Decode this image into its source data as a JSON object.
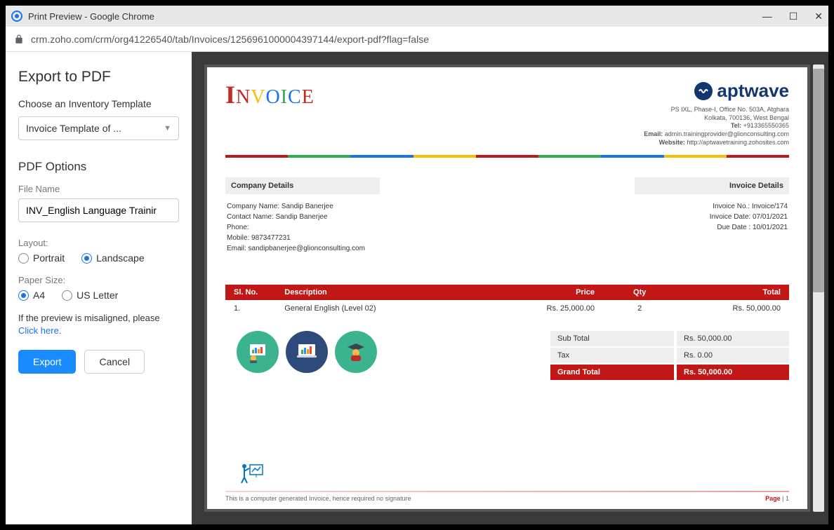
{
  "window": {
    "title": "Print Preview - Google Chrome",
    "url": "crm.zoho.com/crm/org41226540/tab/Invoices/1256961000004397144/export-pdf?flag=false"
  },
  "sidebar": {
    "heading": "Export to PDF",
    "template_label": "Choose an Inventory Template",
    "template_value": "Invoice Template of ...",
    "pdf_options_heading": "PDF Options",
    "filename_label": "File Name",
    "filename_value": "INV_English Language Trainir",
    "layout_label": "Layout:",
    "layout_options": {
      "portrait": "Portrait",
      "landscape": "Landscape"
    },
    "layout_selected": "landscape",
    "paper_label": "Paper Size:",
    "paper_options": {
      "a4": "A4",
      "usletter": "US Letter"
    },
    "paper_selected": "a4",
    "misaligned_text": "If the preview is misaligned, please",
    "click_here": "Click here.",
    "export_btn": "Export",
    "cancel_btn": "Cancel"
  },
  "invoice": {
    "title_chars": [
      "I",
      "N",
      "V",
      "O",
      "I",
      "C",
      "E"
    ],
    "brand_name": "aptwave",
    "address_line1": "PS IXL, Phase-I, Office No. 503A, Atghara",
    "address_line2": "Kolkata, 700136, West Bengal",
    "tel_label": "Tel:",
    "tel": "+913365550365",
    "email_label": "Email:",
    "email": "admin.trainingprovider@glionconsulting.com",
    "website_label": "Website:",
    "website": "http://aptwavetraining.zohosites.com",
    "company_details_heading": "Company Details",
    "company_name": "Company Name: Sandip Banerjee",
    "contact_name": "Contact Name: Sandip Banerjee",
    "phone": "Phone:",
    "mobile": "Mobile: 9873477231",
    "cust_email": "Email: sandipbanerjee@glionconsulting.com",
    "invoice_details_heading": "Invoice Details",
    "invoice_no": "Invoice No.: Invoice/174",
    "invoice_date": "Invoice Date: 07/01/2021",
    "due_date": "Due Date : 10/01/2021",
    "table": {
      "headers": {
        "sl": "Sl. No.",
        "desc": "Description",
        "price": "Price",
        "qty": "Qty",
        "total": "Total"
      },
      "row1": {
        "sl": "1.",
        "desc": "General English (Level 02)",
        "price": "Rs. 25,000.00",
        "qty": "2",
        "total": "Rs. 50,000.00"
      }
    },
    "totals": {
      "subtotal_label": "Sub Total",
      "subtotal_value": "Rs. 50,000.00",
      "tax_label": "Tax",
      "tax_value": "Rs. 0.00",
      "grand_label": "Grand Total",
      "grand_value": "Rs. 50,000.00"
    },
    "footer_text": "This is a computer generated Invoice, hence required no signature",
    "page_label": "Page",
    "page_num": "1"
  }
}
